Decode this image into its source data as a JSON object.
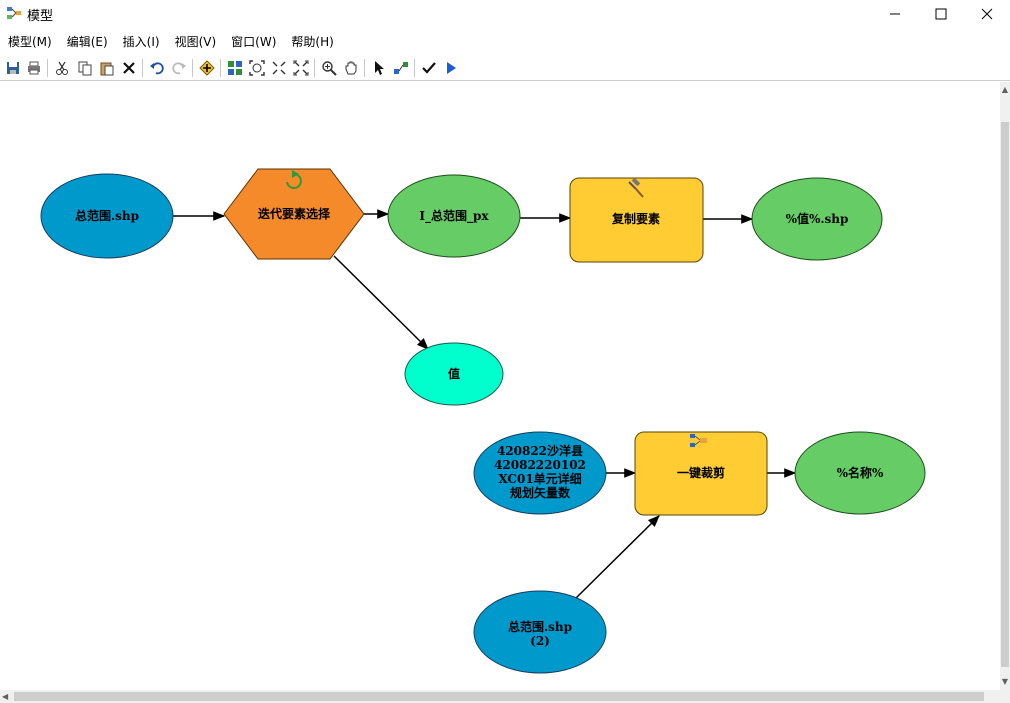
{
  "window": {
    "title": "模型"
  },
  "menu": [
    "模型(M)",
    "编辑(E)",
    "插入(I)",
    "视图(V)",
    "窗口(W)",
    "帮助(H)"
  ],
  "toolbar": {
    "icons": [
      "save-icon",
      "print-icon",
      "cut-icon",
      "copy-icon",
      "paste-icon",
      "delete-icon",
      "undo-icon",
      "redo-icon",
      "add-data-icon",
      "auto-layout-icon",
      "full-extent-icon",
      "zoom-in-fixed-icon",
      "zoom-out-fixed-icon",
      "zoom-in-icon",
      "pan-icon",
      "select-icon",
      "connect-icon",
      "validate-icon",
      "run-icon"
    ]
  },
  "diagram": {
    "nodes": {
      "input_shp": "总范围.shp",
      "iterator": "迭代要素选择",
      "iter_output": "I_总范围_px",
      "copy_tool": "复制要素",
      "copy_output": "%值%.shp",
      "value": "值",
      "param_line1": "420822沙洋县",
      "param_line2": "42082220102",
      "param_line3": "XC01单元详细",
      "param_line4": "规划矢量数",
      "clip_tool": "一键裁剪",
      "clip_output": "%名称%",
      "input_shp2_line1": "总范围.shp",
      "input_shp2_line2": "(2)"
    },
    "colors": {
      "input": "#0099cc",
      "iterator": "#f58a2b",
      "derived": "#66cc66",
      "tool": "#ffcc33",
      "value": "#00ffcc"
    }
  }
}
